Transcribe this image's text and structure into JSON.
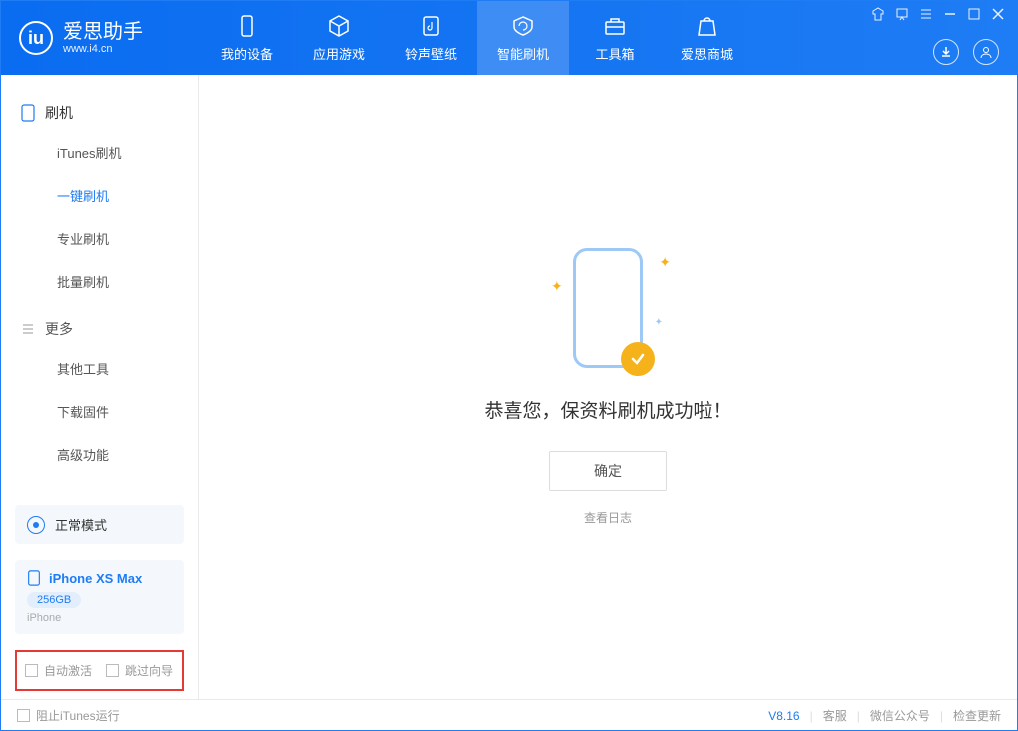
{
  "app": {
    "name_cn": "爱思助手",
    "url": "www.i4.cn"
  },
  "nav": [
    {
      "label": "我的设备",
      "icon": "device"
    },
    {
      "label": "应用游戏",
      "icon": "cube"
    },
    {
      "label": "铃声壁纸",
      "icon": "music"
    },
    {
      "label": "智能刷机",
      "icon": "refresh",
      "active": true
    },
    {
      "label": "工具箱",
      "icon": "toolbox"
    },
    {
      "label": "爱思商城",
      "icon": "store"
    }
  ],
  "sidebar": {
    "section_a_title": "刷机",
    "section_a_items": [
      "iTunes刷机",
      "一键刷机",
      "专业刷机",
      "批量刷机"
    ],
    "section_a_active_index": 1,
    "section_b_title": "更多",
    "section_b_items": [
      "其他工具",
      "下载固件",
      "高级功能"
    ]
  },
  "mode": {
    "label": "正常模式"
  },
  "device": {
    "name": "iPhone XS Max",
    "storage": "256GB",
    "type": "iPhone"
  },
  "checkboxes": {
    "a": "自动激活",
    "b": "跳过向导"
  },
  "main": {
    "success_text": "恭喜您，保资料刷机成功啦！",
    "ok_button": "确定",
    "view_log": "查看日志"
  },
  "footer": {
    "block_itunes": "阻止iTunes运行",
    "version": "V8.16",
    "links": [
      "客服",
      "微信公众号",
      "检查更新"
    ]
  }
}
